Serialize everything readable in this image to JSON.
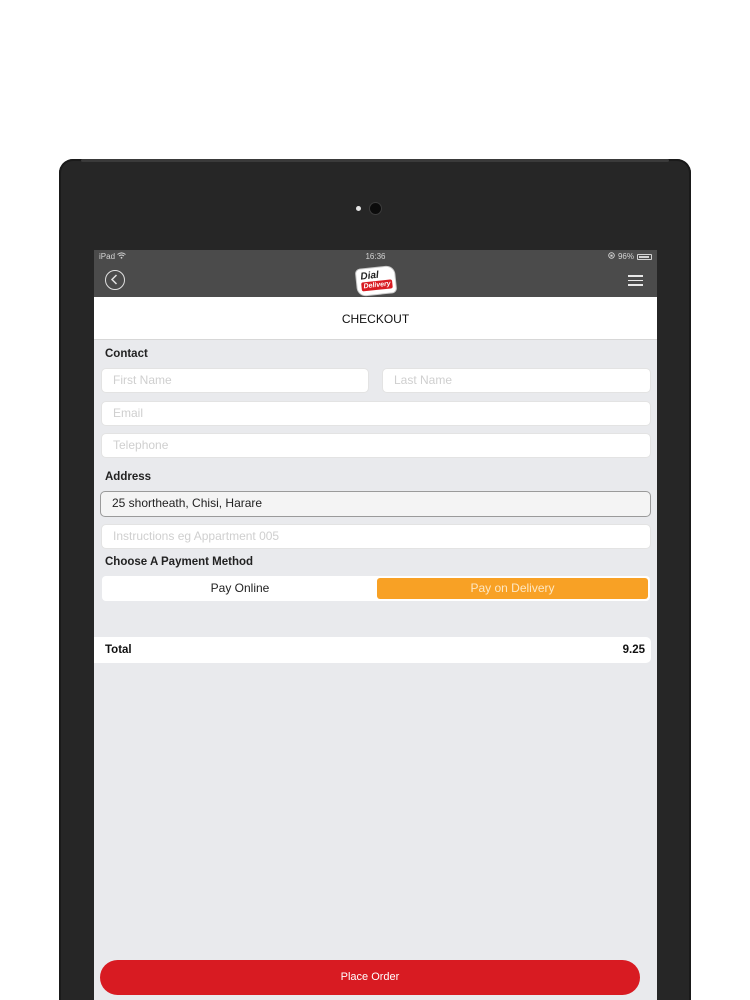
{
  "status_bar": {
    "carrier": "iPad",
    "time": "16:36",
    "battery": "96%"
  },
  "nav": {
    "logo_top": "Dial",
    "logo_bottom": "Delivery"
  },
  "page": {
    "title": "CHECKOUT"
  },
  "contact": {
    "label": "Contact",
    "first_name_placeholder": "First Name",
    "last_name_placeholder": "Last Name",
    "email_placeholder": "Email",
    "telephone_placeholder": "Telephone"
  },
  "address": {
    "label": "Address",
    "value": "25 shortheath, Chisi, Harare",
    "instructions_placeholder": "Instructions eg Appartment 005"
  },
  "payment": {
    "label": "Choose A Payment Method",
    "options": [
      "Pay Online",
      "Pay on Delivery"
    ],
    "selected": "Pay on Delivery",
    "accent_color": "#f8a125"
  },
  "summary": {
    "total_label": "Total",
    "total_value": "9.25"
  },
  "actions": {
    "place_order_label": "Place Order",
    "button_color": "#d81b22"
  }
}
